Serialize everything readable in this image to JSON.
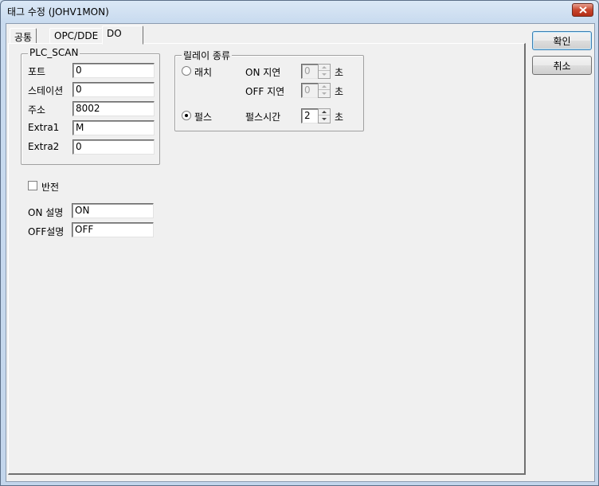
{
  "window": {
    "title": "태그 수정 (JOHV1MON)"
  },
  "tabs": [
    {
      "label": "공통"
    },
    {
      "label": "OPC/DDE"
    },
    {
      "label": "DO",
      "active": true
    }
  ],
  "plc_scan": {
    "title": "PLC_SCAN",
    "fields": [
      {
        "label": "포트",
        "value": "0"
      },
      {
        "label": "스테이션",
        "value": "0"
      },
      {
        "label": "주소",
        "value": "8002"
      },
      {
        "label": "Extra1",
        "value": "M"
      },
      {
        "label": "Extra2",
        "value": "0"
      }
    ]
  },
  "relay": {
    "title": "릴레이 종류",
    "latch_label": "래치",
    "latch_selected": false,
    "on_delay_label": "ON 지연",
    "on_delay_value": "0",
    "off_delay_label": "OFF 지연",
    "off_delay_value": "0",
    "pulse_label": "펄스",
    "pulse_selected": true,
    "pulse_time_label": "펄스시간",
    "pulse_time_value": "2",
    "unit": "초"
  },
  "invert": {
    "label": "반전",
    "checked": false
  },
  "on_desc": {
    "label": "ON 설명",
    "value": "ON"
  },
  "off_desc": {
    "label": "OFF설명",
    "value": "OFF"
  },
  "buttons": {
    "ok": "확인",
    "cancel": "취소"
  }
}
